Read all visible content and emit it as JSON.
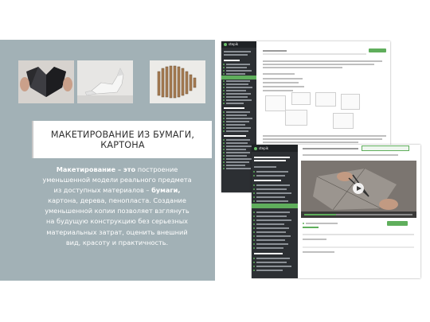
{
  "slide": {
    "title": "МАКЕТИРОВАНИЕ ИЗ БУМАГИ, КАРТОНА",
    "description": {
      "term": "Макетирование – это",
      "part1": " построение уменьшенной модели реального предмета из доступных материалов – ",
      "bold_material": "бумаги,",
      "part2": " картона, дерева, пенопласта. Создание уменьшенной копии позволяет взглянуть на будущую конструкцию без серьезных материальных затрат, оценить внешний вид, красоту и практичность."
    },
    "photos": [
      {
        "name": "folded-paper-heart-photo"
      },
      {
        "name": "paper-cat-sculpture-photo"
      },
      {
        "name": "cardboard-animal-model-photo"
      }
    ]
  },
  "screenshots": {
    "brand": "stepik",
    "colors": {
      "sidebar": "#2c2f33",
      "accent": "#5fae5c",
      "left_panel": "#a2b1b6"
    }
  }
}
